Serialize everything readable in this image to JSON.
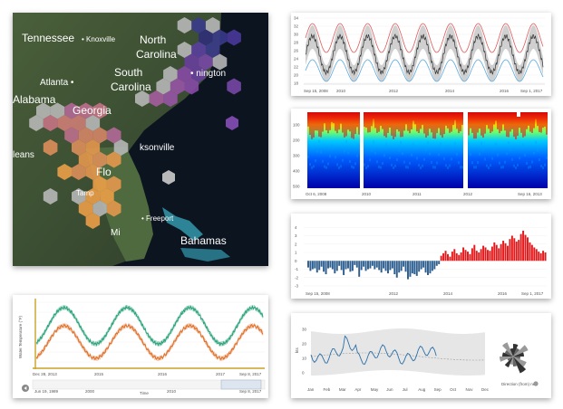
{
  "map": {
    "states": [
      {
        "id": "tennessee",
        "text": "Tennessee"
      },
      {
        "id": "north",
        "text": "North"
      },
      {
        "id": "carolina-n",
        "text": "Carolina"
      },
      {
        "id": "south",
        "text": "South"
      },
      {
        "id": "carolina-s",
        "text": "Carolina"
      },
      {
        "id": "alabama",
        "text": "Alabama"
      },
      {
        "id": "georgia",
        "text": "Georgia"
      },
      {
        "id": "bahamas",
        "text": "Bahamas"
      }
    ],
    "cities": [
      {
        "id": "knoxville",
        "text": "Knoxville"
      },
      {
        "id": "atlanta",
        "text": "Atlanta"
      },
      {
        "id": "wilmington",
        "text": "nington"
      },
      {
        "id": "jacksonville",
        "text": "ksonville"
      },
      {
        "id": "orleans",
        "text": "leans"
      },
      {
        "id": "florida",
        "text": "Flo"
      },
      {
        "id": "tampa",
        "text": "Tamp"
      },
      {
        "id": "freeport",
        "text": "Freeport"
      },
      {
        "id": "miami",
        "text": "Mi"
      }
    ]
  },
  "panel_top_right": {
    "y_ticks": [
      "34",
      "32",
      "30",
      "28",
      "26",
      "24",
      "22",
      "20",
      "18"
    ],
    "x_start": "Sep 15, 2008",
    "x_end": "Sep 1, 2017",
    "x_ticks": [
      "2010",
      "2012",
      "2014",
      "2016"
    ],
    "colors": {
      "red": "#e05a5a",
      "blue": "#5aa9e0",
      "black": "#333333",
      "band": "#b0b0b0"
    }
  },
  "panel_heatmap": {
    "y_ticks": [
      "100",
      "200",
      "300",
      "400",
      "500"
    ],
    "x_start": "Oct 6, 2008",
    "x_end": "Sep 16, 2013",
    "x_ticks": [
      "2010",
      "2011",
      "2012"
    ]
  },
  "panel_bars": {
    "y_ticks": [
      "4",
      "3",
      "2",
      "1",
      "0",
      "-1",
      "-2",
      "-3"
    ],
    "x_start": "Sep 15, 2008",
    "x_end": "Sep 1, 2017",
    "x_ticks": [
      "2012",
      "2014",
      "2016"
    ],
    "chart_data": {
      "type": "bar",
      "x_range": [
        "Sep 15, 2008",
        "Sep 1, 2017"
      ],
      "ylim": [
        -3,
        5
      ],
      "series": [
        {
          "values": [
            -0.8,
            -1.2,
            -1.0,
            -0.9,
            -1.4,
            -1.1,
            -0.7,
            -1.3,
            -1.6,
            -0.9,
            -0.8,
            -1.0,
            -1.5,
            -1.2,
            -0.6,
            -1.1,
            -1.7,
            -1.0,
            -0.9,
            -1.3,
            -1.2,
            -0.5,
            -0.8,
            -1.9,
            -1.1,
            -0.7,
            -1.2,
            -1.0,
            -0.9,
            -0.6,
            -1.0,
            -0.8,
            -1.1,
            -1.4,
            -0.9,
            -1.2,
            -1.5,
            -1.1,
            -0.9,
            -1.6,
            -2.0,
            -1.4,
            -1.2,
            -0.7,
            -1.3,
            -2.2,
            -1.9,
            -1.5,
            -1.6,
            -1.8,
            -1.3,
            -1.0,
            -0.8,
            -1.4,
            -1.7,
            -1.5,
            -1.2,
            -1.0,
            -0.6,
            -0.4
          ]
        },
        {
          "values": [
            0.6,
            0.9,
            1.2,
            0.8,
            0.5,
            1.1,
            1.4,
            0.9,
            0.7,
            1.0,
            1.6,
            1.3,
            1.1,
            0.8,
            1.5,
            1.9,
            1.2,
            1.0,
            1.4,
            1.8,
            1.6,
            1.3,
            1.2,
            1.7,
            2.2,
            1.9,
            1.5,
            2.0,
            2.4,
            2.1,
            1.8,
            2.6,
            3.0,
            2.7,
            2.3,
            2.5,
            3.2,
            3.6,
            3.1,
            2.8,
            2.2,
            1.9,
            1.6,
            1.4,
            1.1,
            0.9,
            1.2,
            1.0
          ]
        }
      ],
      "colors": {
        "negative": "#2e5f8f",
        "positive": "#e31a1c"
      }
    }
  },
  "panel_lines": {
    "y_label": "Water Temperature (°F)",
    "x_label": "Time",
    "x_start": "Dec 28, 2013",
    "x_end": "Sep 8, 2017",
    "nav_start": "Jun 19, 1989",
    "nav_end": "Sep 8, 2017",
    "x_ticks": [
      "2015",
      "2016",
      "2017"
    ],
    "nav_ticks": [
      "2000",
      "2010"
    ],
    "colors": {
      "green": "#2ba37a",
      "orange": "#e0702a",
      "gold": "#c9a227"
    }
  },
  "panel_bottom_right": {
    "y_label": "kts",
    "months": [
      "Jan",
      "Feb",
      "Mar",
      "Apr",
      "May",
      "Jun",
      "Jul",
      "Aug",
      "Sep",
      "Oct",
      "Nov",
      "Dec"
    ],
    "rose_label": "Direction (from) now",
    "colors": {
      "line": "#2a6fa8",
      "band": "#e6e6e6"
    }
  }
}
